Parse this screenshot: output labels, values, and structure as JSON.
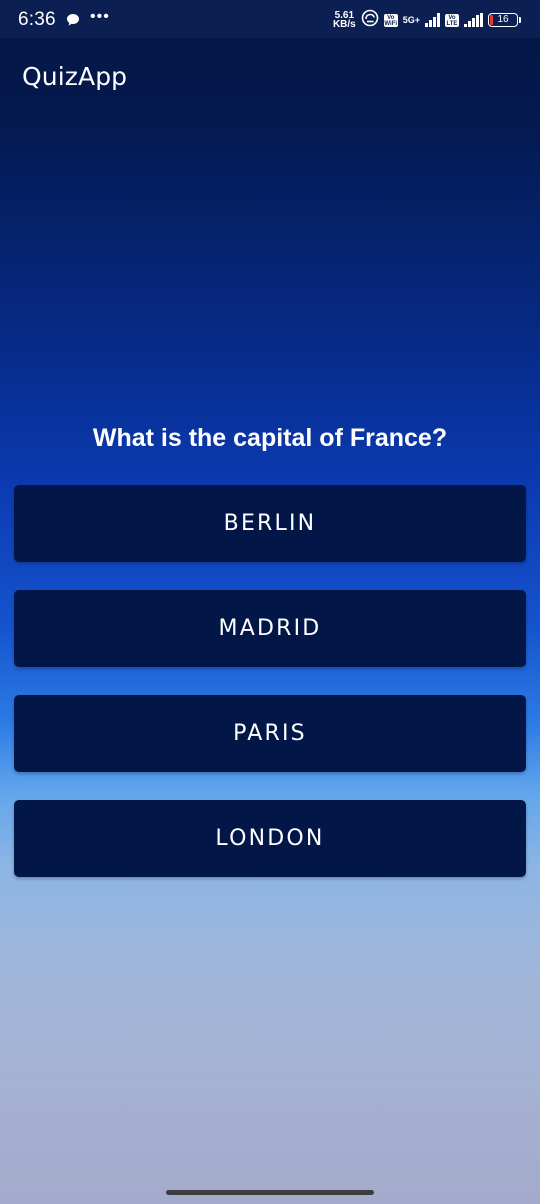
{
  "status_bar": {
    "time": "6:36",
    "speed_value": "5.61",
    "speed_unit": "KB/s",
    "network_badge_1": "Vo\nWiFi",
    "network_type": "5G+",
    "network_badge_2": "Vo\nLTE",
    "battery_level": "16",
    "icons": [
      "chat-bubble-icon",
      "more-dots-icon",
      "hotspot-icon",
      "signal-icon",
      "battery-icon"
    ]
  },
  "app": {
    "title": "QuizApp"
  },
  "quiz": {
    "question": "What is the capital of France?",
    "answers": [
      {
        "label": "BERLIN"
      },
      {
        "label": "MADRID"
      },
      {
        "label": "PARIS"
      },
      {
        "label": "LONDON"
      }
    ]
  },
  "colors": {
    "button_background": "#021648",
    "status_bar_background": "#0b1f52",
    "text": "#ffffff"
  }
}
